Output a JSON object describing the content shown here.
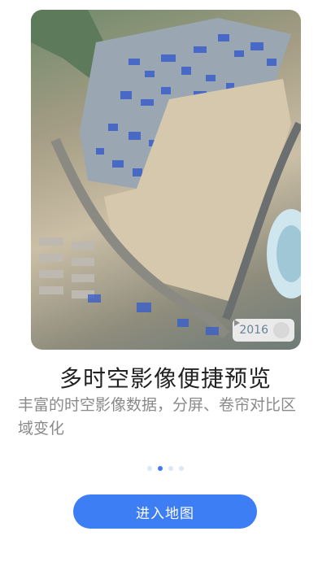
{
  "preview": {
    "year": "2016",
    "colors": {
      "accent": "#3e7ef5",
      "roof_blue": "#3a5fc8",
      "bare_soil": "#d6c8ad"
    }
  },
  "onboarding": {
    "title": "多时空影像便捷预览",
    "description": "丰富的时空影像数据，分屏、卷帘对比区域变化",
    "page_count": 4,
    "current_page": 2
  },
  "actions": {
    "enter_map_label": "进入地图"
  },
  "icons": {
    "play": "play-icon"
  }
}
